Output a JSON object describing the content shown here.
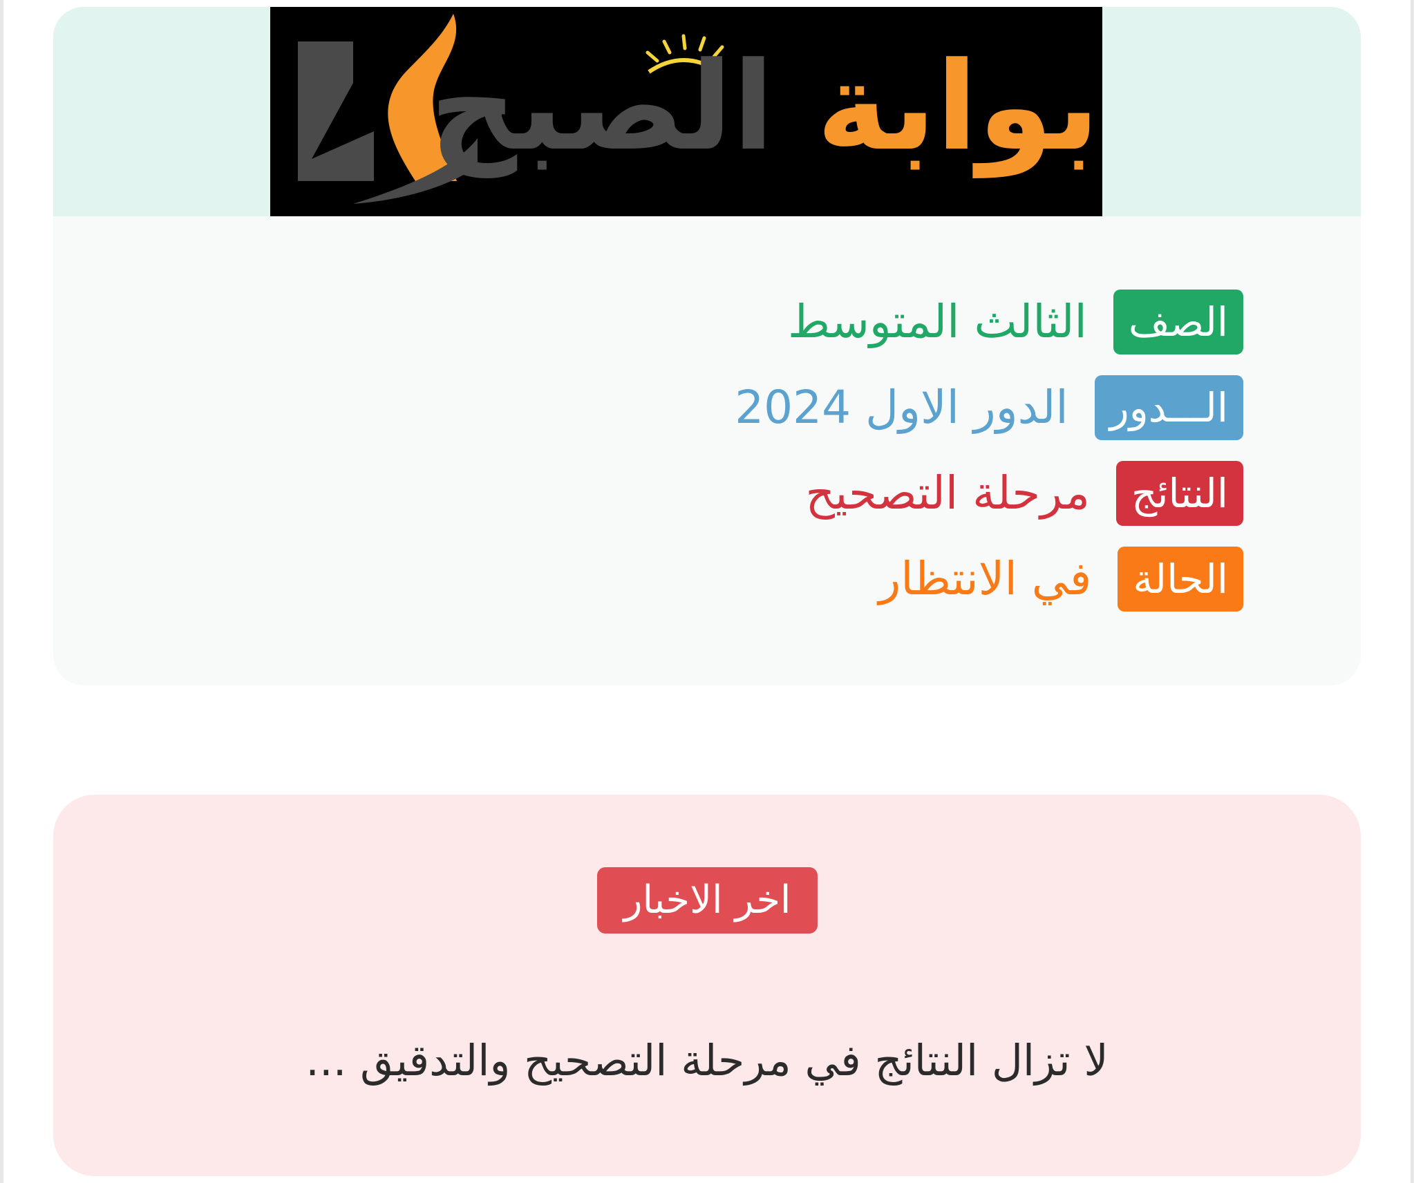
{
  "logo": {
    "text_part1": "بوابة",
    "text_part2": "الصبح",
    "colors": {
      "background": "#000000",
      "primary": "#f7962a",
      "secondary": "#4a4a4a"
    }
  },
  "info": {
    "rows": [
      {
        "badge": "الصف",
        "value": "الثالث المتوسط",
        "color": "#22a866"
      },
      {
        "badge": "الـــدور",
        "value": "الدور الاول 2024",
        "color": "#5ca2cf"
      },
      {
        "badge": "النتائج",
        "value": "مرحلة التصحيح",
        "color": "#d3333f"
      },
      {
        "badge": "الحالة",
        "value": "في الانتظار",
        "color": "#f97a16"
      }
    ]
  },
  "news": {
    "badge": "اخر الاخبار",
    "message": "لا تزال النتائج في مرحلة التصحيح والتدقيق ..."
  }
}
